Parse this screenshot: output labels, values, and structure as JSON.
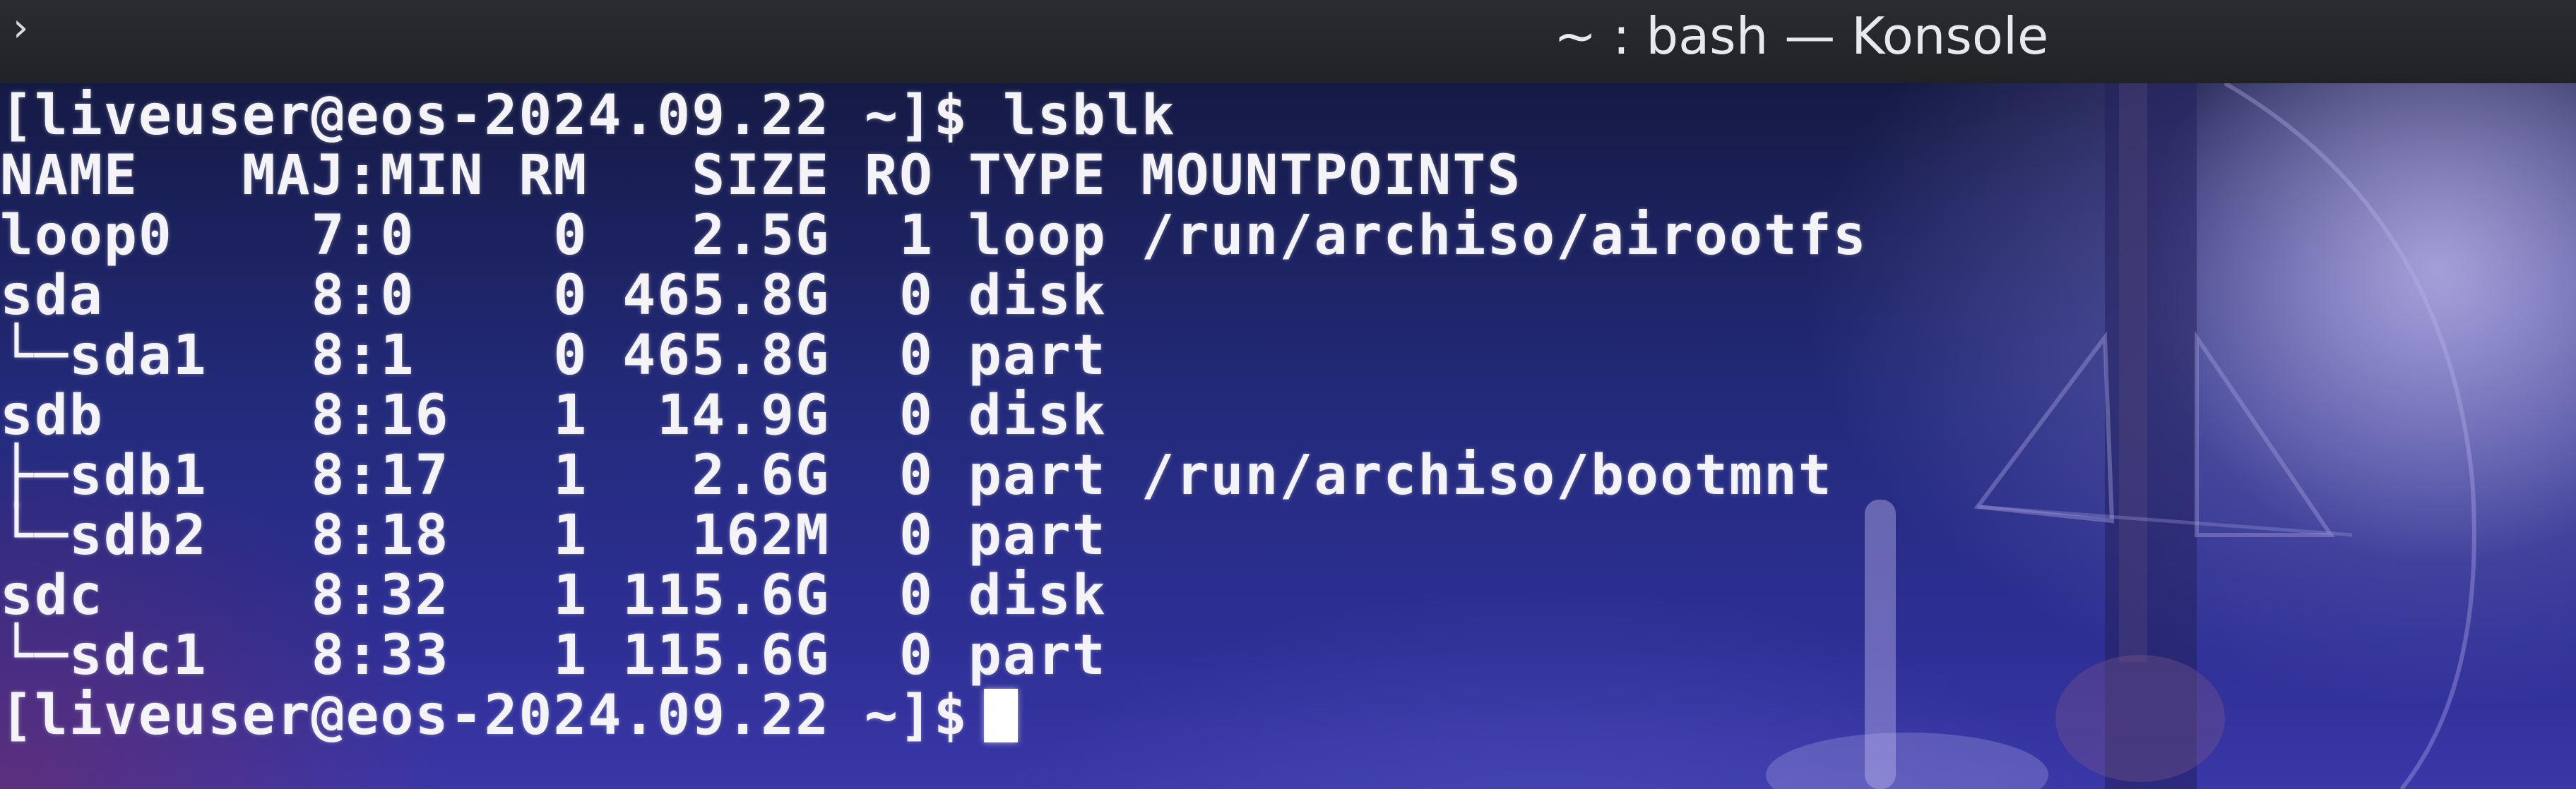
{
  "window": {
    "title": "~ : bash — Konsole",
    "menu_glyph": "›"
  },
  "terminal": {
    "lines": [
      "[liveuser@eos-2024.09.22 ~]$ lsblk",
      "NAME   MAJ:MIN RM   SIZE RO TYPE MOUNTPOINTS",
      "loop0    7:0    0   2.5G  1 loop /run/archiso/airootfs",
      "sda      8:0    0 465.8G  0 disk",
      "└─sda1   8:1    0 465.8G  0 part",
      "sdb      8:16   1  14.9G  0 disk",
      "├─sdb1   8:17   1   2.6G  0 part /run/archiso/bootmnt",
      "└─sdb2   8:18   1   162M  0 part",
      "sdc      8:32   1 115.6G  0 disk",
      "└─sdc1   8:33   1 115.6G  0 part"
    ],
    "prompt": "[liveuser@eos-2024.09.22 ~]$"
  },
  "colors": {
    "text": "#f4f4f8",
    "titlebar": "#202226",
    "background_top": "#151a44",
    "background_bottom": "#3a37a8"
  }
}
